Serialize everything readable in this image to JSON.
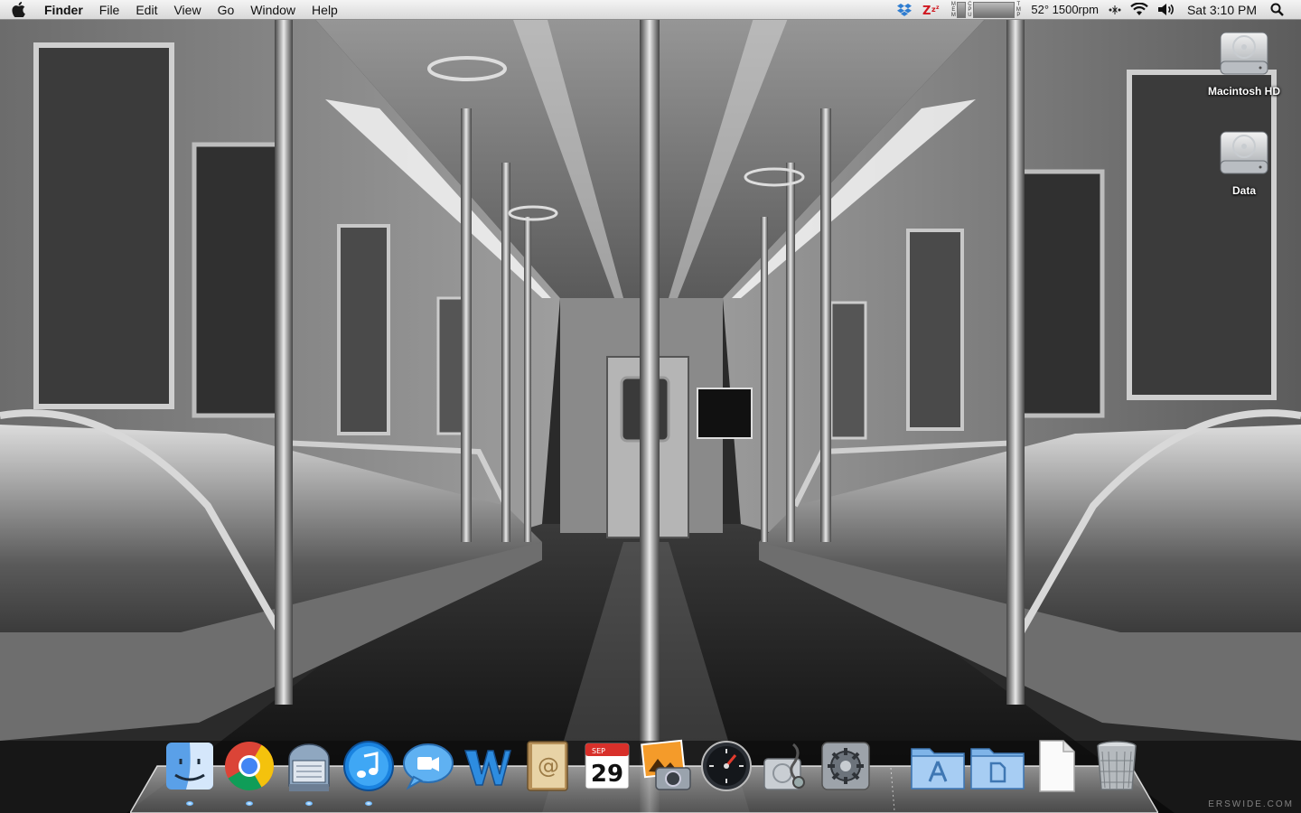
{
  "menubar": {
    "app_name": "Finder",
    "menus": [
      "File",
      "Edit",
      "View",
      "Go",
      "Window",
      "Help"
    ],
    "status": {
      "meter_labels": [
        "MEM",
        "CPU",
        "TMP"
      ],
      "temp_fan": "52° 1500rpm",
      "clock": "Sat 3:10 PM"
    }
  },
  "desktop": {
    "icons": [
      {
        "label": "Macintosh HD",
        "icon": "hard-drive-icon"
      },
      {
        "label": "Data",
        "icon": "hard-drive-icon"
      }
    ]
  },
  "dock": {
    "items": [
      {
        "name": "finder",
        "icon": "finder-icon",
        "running": true
      },
      {
        "name": "chrome",
        "icon": "chrome-icon",
        "running": true
      },
      {
        "name": "mail-app",
        "icon": "mailbox-icon",
        "running": true
      },
      {
        "name": "itunes",
        "icon": "itunes-icon",
        "running": true
      },
      {
        "name": "ichat",
        "icon": "ichat-icon",
        "running": false
      },
      {
        "name": "word",
        "icon": "word-icon",
        "running": false
      },
      {
        "name": "address-book",
        "icon": "address-book-icon",
        "running": false
      },
      {
        "name": "ical",
        "icon": "calendar-icon",
        "running": false,
        "month": "SEP",
        "day": "29"
      },
      {
        "name": "iphoto",
        "icon": "iphoto-icon",
        "running": false
      },
      {
        "name": "dashboard",
        "icon": "dashboard-icon",
        "running": false
      },
      {
        "name": "disk-utility",
        "icon": "disk-utility-icon",
        "running": false
      },
      {
        "name": "system-preferences",
        "icon": "system-preferences-icon",
        "running": false
      },
      {
        "name": "applications-folder",
        "icon": "applications-folder-icon",
        "running": false
      },
      {
        "name": "documents-folder",
        "icon": "documents-folder-icon",
        "running": false
      },
      {
        "name": "document-stack",
        "icon": "document-icon",
        "running": false
      },
      {
        "name": "trash",
        "icon": "trash-icon",
        "running": false
      }
    ]
  },
  "watermark": "ERSWIDE.COM",
  "colors": {
    "menubar_top": "#f4f4f4",
    "menubar_bottom": "#d9d9d9",
    "running_light": "#6bb8ff"
  }
}
